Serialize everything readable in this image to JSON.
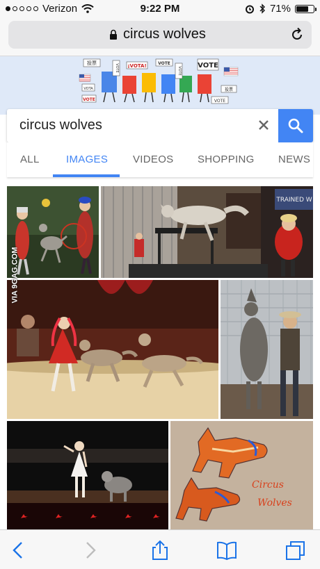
{
  "status": {
    "carrier": "Verizon",
    "time": "9:22 PM",
    "battery": "71%",
    "battery_level": 0.71
  },
  "browser": {
    "url_text": "circus wolves"
  },
  "doodle": {
    "signs": [
      "投票",
      "VOTE",
      "¡VOTA!",
      "VOTE",
      "VOTE",
      "VOTE",
      "VOTA",
      "VOTE",
      "投票",
      "VOTE"
    ]
  },
  "search": {
    "query": "circus wolves"
  },
  "tabs": [
    {
      "label": "ALL",
      "active": false
    },
    {
      "label": "IMAGES",
      "active": true
    },
    {
      "label": "VIDEOS",
      "active": false
    },
    {
      "label": "SHOPPING",
      "active": false
    },
    {
      "label": "NEWS",
      "active": false
    }
  ],
  "results": {
    "watermark": "VIA 9GAG.COM",
    "tile_texts": {
      "sign": "TRAINED W",
      "drawing": [
        "Circus",
        "Wolves"
      ]
    }
  },
  "colors": {
    "accent": "#4285f4",
    "tab_inactive": "#666666",
    "doodle_bg": "#dfe9f8",
    "ios_tint": "#1a73e8"
  },
  "icons": [
    "lock-icon",
    "reload-icon",
    "clear-icon",
    "search-icon",
    "back-icon",
    "forward-icon",
    "share-icon",
    "bookmarks-icon",
    "tabs-icon"
  ]
}
